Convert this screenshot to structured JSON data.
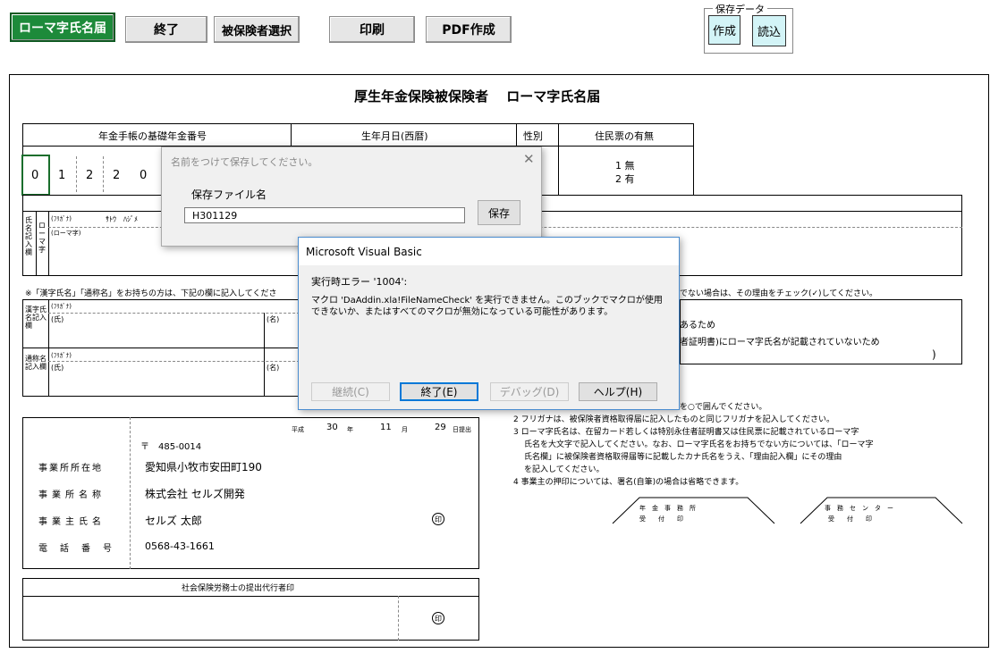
{
  "toolbar": {
    "title_button": "ローマ字氏名届",
    "exit_button": "終了",
    "select_insured_button": "被保険者選択",
    "print_button": "印刷",
    "pdf_button": "PDF作成"
  },
  "save_data": {
    "legend": "保存データ",
    "create_button": "作成",
    "load_button": "読込"
  },
  "form": {
    "title": "厚生年金保険被保険者　 ローマ字氏名届",
    "header_pension": "年金手帳の基礎年金番号",
    "header_birth": "生年月日(西暦)",
    "header_sex": "性別",
    "header_residence": "住民票の有無",
    "pension_digits": [
      "0",
      "1",
      "2",
      "2",
      "0"
    ],
    "residence_opt1": "1 無",
    "residence_opt2": "2 有",
    "name_section_labels": "氏名記入欄",
    "roman_label": "ローマ字",
    "furigana_label": "(ﾌﾘｶﾞﾅ)",
    "furigana_value": "ｻﾄｳ　ﾊｼﾞﾒ",
    "roman_sub": "(ローマ字)",
    "kanji_note": "※「漢字氏名」「通称名」をお持ちの方は、下記の欄に記入してくださ",
    "right_note": "でない場合は、その理由をチェック(✓)してください。",
    "kanji_label": "漢字氏名記入欄",
    "alias_label": "通称名記入欄",
    "sei_label": "(氏)",
    "mei_label": "(名)",
    "reason1": "あるため",
    "reason2": "者証明書)にローマ字氏名が記載されていないため",
    "paren_close": ")",
    "date_era": "平成",
    "date_year": "30",
    "year_label": "年",
    "date_month": "11",
    "month_label": "月",
    "date_day": "29",
    "day_label": "日提出",
    "postal": "〒　485-0014",
    "address_label": "事業所所在地",
    "address_value": "愛知県小牧市安田町190",
    "office_name_label": "事業所名称",
    "office_name_value": "株式会社 セルズ開発",
    "owner_label": "事業主氏名",
    "owner_value": "セルズ 太郎",
    "phone_label": "電話番号",
    "phone_value": "0568-43-1661",
    "seal_char": "印",
    "agent_header": "社会保険労務士の提出代行者印",
    "note1": "を○で囲んでください。",
    "note2": "2 フリガナは、被保険者資格取得届に記入したものと同じフリガナを記入してください。",
    "note3a": "3 ローマ字氏名は、在留カード若しくは特別永住者証明書又は住民票に記載されているローマ字",
    "note3b": "氏名を大文字で記入してください。なお、ローマ字氏名をお持ちでない方については、「ローマ字",
    "note3c": "氏名欄」に被保険者資格取得届等に記載したカナ氏名をうえ、「理由記入欄」にその理由",
    "note3d": "を記入してください。",
    "note4": "4 事業主の押印については、署名(自筆)の場合は省略できます。",
    "stamp1_top": "年　金　事　務　所",
    "stamp1_bot": "受　　付　　印",
    "stamp2_top": "事　務　セ　ン　タ　ー",
    "stamp2_bot": "受　　付　　印"
  },
  "save_dialog": {
    "title": "名前をつけて保存してください。",
    "label": "保存ファイル名",
    "value": "H301129",
    "save_button": "保存"
  },
  "vb_dialog": {
    "title": "Microsoft Visual Basic",
    "error_title": "実行時エラー '1004':",
    "message": "マクロ 'DaAddin.xla!FileNameCheck' を実行できません。このブックでマクロが使用できないか、またはすべてのマクロが無効になっている可能性があります。",
    "continue_button": "継続(C)",
    "end_button": "終了(E)",
    "debug_button": "デバッグ(D)",
    "help_button": "ヘルプ(H)"
  }
}
